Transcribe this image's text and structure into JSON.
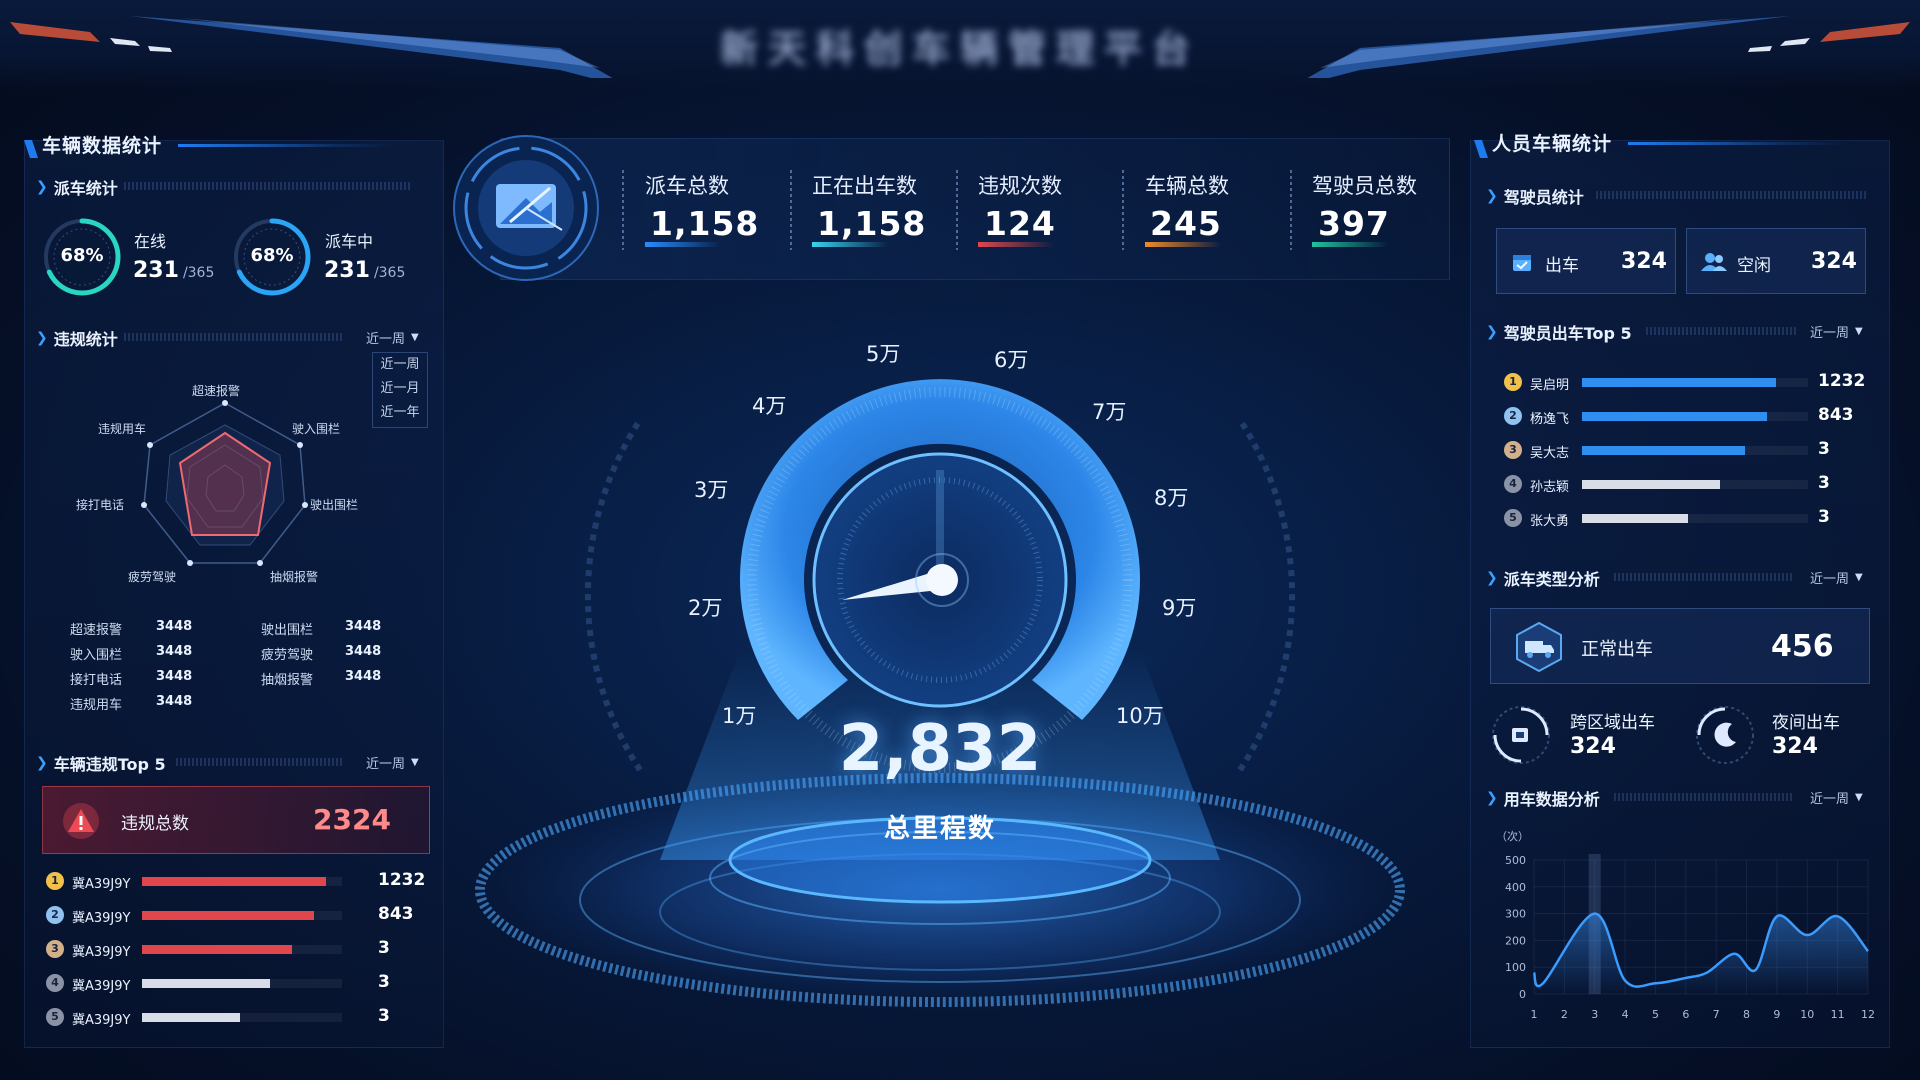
{
  "header": {
    "title": "新天科创车辆管理平台"
  },
  "colors": {
    "accent": "#2a8cff",
    "danger": "#e0474c",
    "orange": "#f08a2a",
    "green": "#20c4a0",
    "cyan": "#3ad4f0"
  },
  "left": {
    "title": "车辆数据统计",
    "dispatch": {
      "title": "派车统计",
      "online": {
        "pct": "68%",
        "label": "在线",
        "value": "231",
        "total": "/365",
        "fraction": 0.68
      },
      "dispatching": {
        "pct": "68%",
        "label": "派车中",
        "value": "231",
        "total": "/365",
        "fraction": 0.68
      }
    },
    "violation": {
      "title": "违规统计",
      "range": "近一周",
      "range_options": [
        "近一周",
        "近一月",
        "近一年"
      ],
      "radar_labels": [
        "超速报警",
        "驶入围栏",
        "驶出围栏",
        "抽烟报警",
        "疲劳驾驶",
        "接打电话",
        "违规用车"
      ],
      "stats_left": [
        {
          "name": "超速报警",
          "value": "3448"
        },
        {
          "name": "驶入围栏",
          "value": "3448"
        },
        {
          "name": "接打电话",
          "value": "3448"
        },
        {
          "name": "违规用车",
          "value": "3448"
        }
      ],
      "stats_right": [
        {
          "name": "驶出围栏",
          "value": "3448"
        },
        {
          "name": "疲劳驾驶",
          "value": "3448"
        },
        {
          "name": "抽烟报警",
          "value": "3448"
        }
      ]
    },
    "top5": {
      "title": "车辆违规Top 5",
      "range": "近一周",
      "total_label": "违规总数",
      "total_value": "2324",
      "rows": [
        {
          "rank": "1",
          "name": "冀A39J9Y",
          "value": "1232",
          "fraction": 0.92
        },
        {
          "rank": "2",
          "name": "冀A39J9Y",
          "value": "843",
          "fraction": 0.86
        },
        {
          "rank": "3",
          "name": "冀A39J9Y",
          "value": "3",
          "fraction": 0.75
        },
        {
          "rank": "4",
          "name": "冀A39J9Y",
          "value": "3",
          "fraction": 0.64
        },
        {
          "rank": "5",
          "name": "冀A39J9Y",
          "value": "3",
          "fraction": 0.49
        }
      ]
    }
  },
  "stats": [
    {
      "label": "派车总数",
      "value": "1,158",
      "color": "#2a8cff"
    },
    {
      "label": "正在出车数",
      "value": "1,158",
      "color": "#3ad4f0"
    },
    {
      "label": "违规次数",
      "value": "124",
      "color": "#e0474c"
    },
    {
      "label": "车辆总数",
      "value": "245",
      "color": "#f08a2a"
    },
    {
      "label": "驾驶员总数",
      "value": "397",
      "color": "#20c4a0"
    }
  ],
  "gauge": {
    "ticks": [
      "1万",
      "2万",
      "3万",
      "4万",
      "5万",
      "6万",
      "7万",
      "8万",
      "9万",
      "10万"
    ],
    "value": "2,832",
    "label": "总里程数",
    "pointer_fraction": 0.03
  },
  "right": {
    "title": "人员车辆统计",
    "drivers": {
      "title": "驾驶员统计",
      "out": {
        "label": "出车",
        "value": "324"
      },
      "idle": {
        "label": "空闲",
        "value": "324"
      }
    },
    "top5": {
      "title": "驾驶员出车Top 5",
      "range": "近一周",
      "rows": [
        {
          "rank": "1",
          "name": "吴启明",
          "value": "1232",
          "fraction": 0.86,
          "color": "#2f8ff0"
        },
        {
          "rank": "2",
          "name": "杨逸飞",
          "value": "843",
          "fraction": 0.82,
          "color": "#2f8ff0"
        },
        {
          "rank": "3",
          "name": "吴大志",
          "value": "3",
          "fraction": 0.72,
          "color": "#2f8ff0"
        },
        {
          "rank": "4",
          "name": "孙志颖",
          "value": "3",
          "fraction": 0.61,
          "color": "#d8dde8"
        },
        {
          "rank": "5",
          "name": "张大勇",
          "value": "3",
          "fraction": 0.47,
          "color": "#d8dde8"
        }
      ]
    },
    "dispatch_type": {
      "title": "派车类型分析",
      "range": "近一周",
      "normal": {
        "label": "正常出车",
        "value": "456"
      },
      "cross": {
        "label": "跨区域出车",
        "value": "324"
      },
      "night": {
        "label": "夜间出车",
        "value": "324"
      }
    },
    "usage": {
      "title": "用车数据分析",
      "range": "近一周"
    }
  },
  "chart_data": {
    "type": "area",
    "ylabel": "（次）",
    "x": [
      "1",
      "2",
      "3",
      "4",
      "5",
      "6",
      "7",
      "8",
      "9",
      "10",
      "11",
      "12"
    ],
    "ylim": [
      0,
      500
    ],
    "yticks": [
      "500",
      "400",
      "300",
      "200",
      "100",
      "0"
    ],
    "series": [
      {
        "values": [
          80,
          40,
          300,
          50,
          40,
          60,
          80,
          150,
          90,
          290,
          220,
          290,
          160
        ]
      }
    ],
    "x_points": [
      1,
      1.3,
      3,
      4,
      5,
      6,
      6.7,
      7.6,
      8.3,
      9,
      10,
      11,
      12
    ],
    "highlight_x": 3
  }
}
